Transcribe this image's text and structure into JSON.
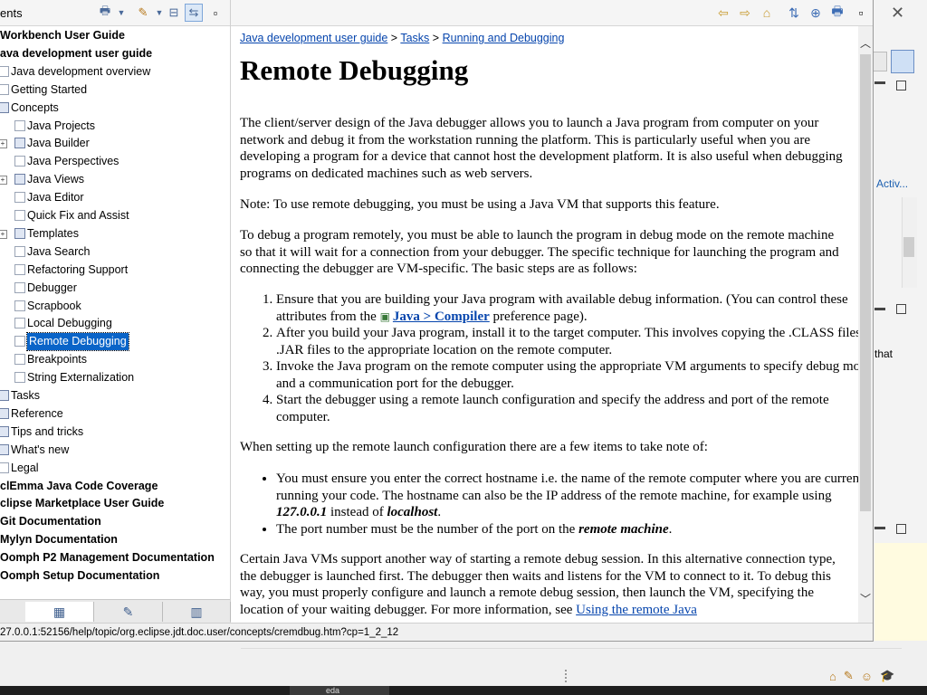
{
  "toc": {
    "title": "ents",
    "items": [
      {
        "label": "Workbench User Guide",
        "bold": true,
        "indent": 0,
        "icon": "none"
      },
      {
        "label": "ava development user guide",
        "bold": true,
        "indent": 0,
        "icon": "none"
      },
      {
        "label": "Java development overview",
        "bold": false,
        "indent": 1,
        "icon": "page"
      },
      {
        "label": "Getting Started",
        "bold": false,
        "indent": 1,
        "icon": "page"
      },
      {
        "label": "Concepts",
        "bold": false,
        "indent": 1,
        "icon": "book"
      },
      {
        "label": "Java Projects",
        "bold": false,
        "indent": 2,
        "icon": "page"
      },
      {
        "label": "Java Builder",
        "bold": false,
        "indent": 2,
        "icon": "book",
        "expand": true
      },
      {
        "label": "Java Perspectives",
        "bold": false,
        "indent": 2,
        "icon": "page"
      },
      {
        "label": "Java Views",
        "bold": false,
        "indent": 2,
        "icon": "book",
        "expand": true
      },
      {
        "label": "Java Editor",
        "bold": false,
        "indent": 2,
        "icon": "page"
      },
      {
        "label": "Quick Fix and Assist",
        "bold": false,
        "indent": 2,
        "icon": "page"
      },
      {
        "label": "Templates",
        "bold": false,
        "indent": 2,
        "icon": "book",
        "expand": true
      },
      {
        "label": "Java Search",
        "bold": false,
        "indent": 2,
        "icon": "page"
      },
      {
        "label": "Refactoring Support",
        "bold": false,
        "indent": 2,
        "icon": "page"
      },
      {
        "label": "Debugger",
        "bold": false,
        "indent": 2,
        "icon": "page"
      },
      {
        "label": "Scrapbook",
        "bold": false,
        "indent": 2,
        "icon": "page"
      },
      {
        "label": "Local Debugging",
        "bold": false,
        "indent": 2,
        "icon": "page"
      },
      {
        "label": "Remote Debugging",
        "bold": false,
        "indent": 2,
        "icon": "page",
        "selected": true
      },
      {
        "label": "Breakpoints",
        "bold": false,
        "indent": 2,
        "icon": "page"
      },
      {
        "label": "String Externalization",
        "bold": false,
        "indent": 2,
        "icon": "page"
      },
      {
        "label": "Tasks",
        "bold": false,
        "indent": 1,
        "icon": "book"
      },
      {
        "label": "Reference",
        "bold": false,
        "indent": 1,
        "icon": "book"
      },
      {
        "label": "Tips and tricks",
        "bold": false,
        "indent": 1,
        "icon": "book"
      },
      {
        "label": "What's new",
        "bold": false,
        "indent": 1,
        "icon": "book"
      },
      {
        "label": "Legal",
        "bold": false,
        "indent": 1,
        "icon": "page"
      },
      {
        "label": "clEmma Java Code Coverage",
        "bold": true,
        "indent": 0,
        "icon": "none"
      },
      {
        "label": "clipse Marketplace User Guide",
        "bold": true,
        "indent": 0,
        "icon": "none"
      },
      {
        "label": "Git Documentation",
        "bold": true,
        "indent": 0,
        "icon": "none"
      },
      {
        "label": "Mylyn Documentation",
        "bold": true,
        "indent": 0,
        "icon": "none"
      },
      {
        "label": "Oomph P2 Management Documentation",
        "bold": true,
        "indent": 0,
        "icon": "none"
      },
      {
        "label": "Oomph Setup Documentation",
        "bold": true,
        "indent": 0,
        "icon": "none"
      }
    ]
  },
  "content": {
    "breadcrumb": {
      "crumb1": "Java development user guide",
      "sep": ">",
      "crumb2": "Tasks",
      "crumb3": "Running and Debugging"
    },
    "title": "Remote Debugging",
    "p1": "The client/server design of the Java debugger allows you to launch a Java program from computer on your network and debug it from the workstation running the platform.  This is particularly useful when you are developing a program for a device that cannot host the development platform.  It is also useful when debugging programs on dedicated machines such as web servers.",
    "note": "Note:  To use remote debugging, you must be using a Java VM that supports this feature.",
    "p2": "To debug a program remotely, you must be able to launch the program in debug mode on the remote machine so that it will wait for a connection from your debugger.  The specific technique for launching the program and connecting the debugger are VM-specific.  The basic steps are as follows:",
    "step1_pre": "Ensure that you are building your Java program with available debug information.  (You can control these attributes from the ",
    "step1_link": "Java > Compiler",
    "step1_post": " preference page).",
    "step2": "After you build your Java program, install it to the target computer.  This involves copying the .CLASS files or .JAR files to the appropriate location on the remote computer.",
    "step3": "Invoke the Java program on the remote computer using the appropriate VM arguments to specify debug mode and a communication port for the debugger.",
    "step4": "Start the debugger using a remote launch configuration and specify the address and port of the remote computer.",
    "p3": "When setting up the remote launch configuration there are a few items to take note of:",
    "bullet1_pre": "You must ensure you enter the correct hostname i.e. the name of the remote computer where you are currently running your code. The hostname can also be the IP address of the remote machine, for example using ",
    "bullet1_ip": "127.0.0.1",
    "bullet1_mid": " instead of ",
    "bullet1_host": "localhost",
    "bullet1_end": ".",
    "bullet2_pre": "The port number must be the number of the port on the ",
    "bullet2_em": "remote machine",
    "bullet2_end": ".",
    "p4_pre": "Certain Java VMs support another way of starting a remote debug session. In this alternative connection type, the debugger is launched first. The debugger then waits and listens for the VM to connect to it. To debug this way, you must properly configure and launch a remote debug session, then launch the VM, specifying the location of your waiting debugger. For more information, see ",
    "p4_link": "Using the remote Java"
  },
  "status_url": "27.0.0.1:52156/help/topic/org.eclipse.jdt.doc.user/concepts/cremdbug.htm?cp=1_2_12",
  "background": {
    "activ_label": "Activ...",
    "that_label": "that",
    "taskbar_label": "eda"
  }
}
